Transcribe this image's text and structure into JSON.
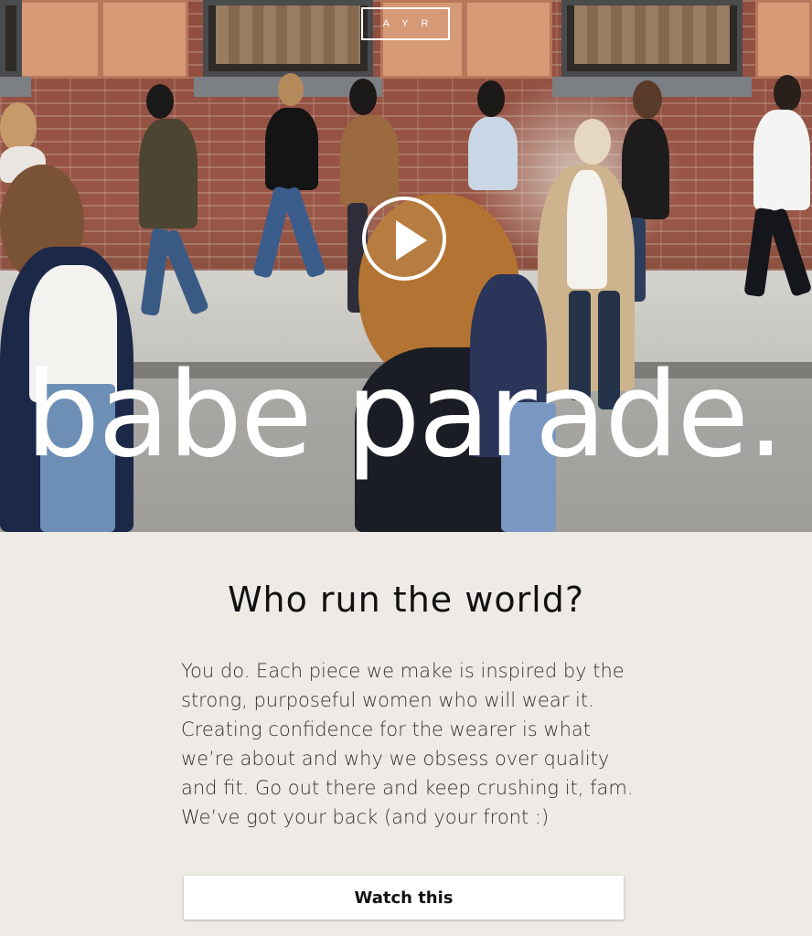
{
  "hero": {
    "logo": "AYR",
    "headline": "babe parade.",
    "play_icon": "play-circle-icon"
  },
  "section": {
    "title": "Who run the world?",
    "body": "You do. Each piece we make is inspired by the strong, purposeful women who will wear it. Creating confidence for the wearer is what we’re about and why we obsess over quality and fit. Go out there and keep crushing it, fam. We’ve got your back (and your front :)",
    "cta_label": "Watch this"
  },
  "colors": {
    "background": "#eeebe7",
    "brick": "#9a5747",
    "text": "#111111",
    "button_bg": "#ffffff"
  }
}
